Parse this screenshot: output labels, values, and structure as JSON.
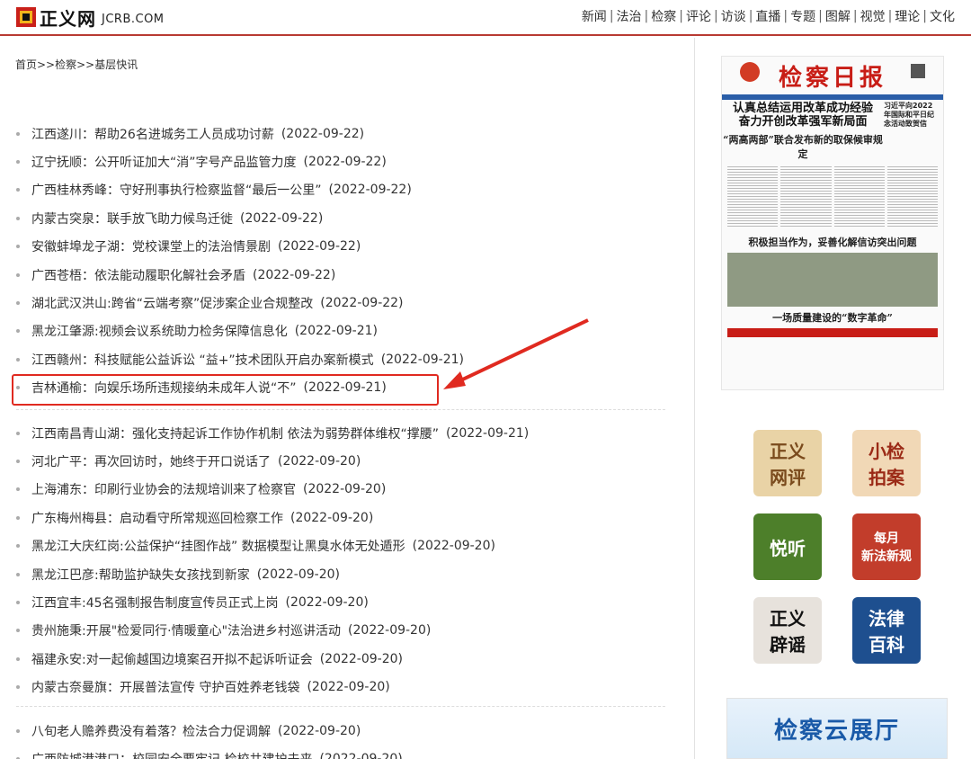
{
  "header": {
    "logo_cn": "正义网",
    "logo_en": "JCRB.COM",
    "nav": [
      "新闻",
      "法治",
      "检察",
      "评论",
      "访谈",
      "直播",
      "专题",
      "图解",
      "视觉",
      "理论",
      "文化"
    ]
  },
  "breadcrumb": "首页>>检察>>基层快讯",
  "news_group_1": [
    {
      "title": "江西遂川：帮助26名进城务工人员成功讨薪",
      "date": "(2022-09-22)"
    },
    {
      "title": "辽宁抚顺：公开听证加大“消”字号产品监管力度",
      "date": "(2022-09-22)"
    },
    {
      "title": "广西桂林秀峰：守好刑事执行检察监督“最后一公里”",
      "date": "(2022-09-22)"
    },
    {
      "title": "内蒙古突泉：联手放飞助力候鸟迁徙",
      "date": "(2022-09-22)"
    },
    {
      "title": "安徽蚌埠龙子湖：党校课堂上的法治情景剧",
      "date": "(2022-09-22)"
    },
    {
      "title": "广西苍梧：依法能动履职化解社会矛盾",
      "date": "(2022-09-22)"
    },
    {
      "title": "湖北武汉洪山:跨省“云端考察”促涉案企业合规整改",
      "date": "(2022-09-22)"
    },
    {
      "title": "黑龙江肇源:视频会议系统助力检务保障信息化",
      "date": "(2022-09-21)"
    },
    {
      "title": "江西赣州：科技赋能公益诉讼 “益+”技术团队开启办案新模式",
      "date": "(2022-09-21)"
    },
    {
      "title": "吉林通榆：向娱乐场所违规接纳未成年人说“不”",
      "date": "(2022-09-21)"
    }
  ],
  "news_group_2": [
    {
      "title": "江西南昌青山湖：强化支持起诉工作协作机制 依法为弱势群体维权“撑腰”",
      "date": "(2022-09-21)"
    },
    {
      "title": "河北广平：再次回访时，她终于开口说话了",
      "date": "(2022-09-20)"
    },
    {
      "title": "上海浦东：印刷行业协会的法规培训来了检察官",
      "date": "(2022-09-20)"
    },
    {
      "title": "广东梅州梅县：启动看守所常规巡回检察工作",
      "date": "(2022-09-20)"
    },
    {
      "title": "黑龙江大庆红岗:公益保护“挂图作战” 数据模型让黑臭水体无处遁形",
      "date": "(2022-09-20)"
    },
    {
      "title": "黑龙江巴彦:帮助监护缺失女孩找到新家",
      "date": "(2022-09-20)"
    },
    {
      "title": "江西宜丰:45名强制报告制度宣传员正式上岗",
      "date": "(2022-09-20)"
    },
    {
      "title": "贵州施秉:开展\"检爱同行·情暖童心\"法治进乡村巡讲活动",
      "date": "(2022-09-20)"
    },
    {
      "title": "福建永安:对一起偷越国边境案召开拟不起诉听证会",
      "date": "(2022-09-20)"
    },
    {
      "title": "内蒙古奈曼旗：开展普法宣传 守护百姓养老钱袋",
      "date": "(2022-09-20)"
    }
  ],
  "news_group_3": [
    {
      "title": "八旬老人赡养费没有着落？检法合力促调解",
      "date": "(2022-09-20)"
    },
    {
      "title": "广西防城港港口：校园安全要牢记 检校共建护未来",
      "date": "(2022-09-20)"
    }
  ],
  "newspaper": {
    "title": "检察日报",
    "headline1": "认真总结运用改革成功经验",
    "headline2": "奋力开创改革强军新局面",
    "sub1": "“两高两部”联合发布新的取保候审规定",
    "sub2": "积极担当作为，妥善化解信访突出问题",
    "sub3": "一场质量建设的“数字革命”",
    "side": "习近平向2022年国际和平日纪念活动致贺信"
  },
  "tiles": [
    {
      "label": "正义\n网评",
      "color": "#7a4a1c",
      "bg": "#e9d3a6"
    },
    {
      "label": "小检\n拍案",
      "color": "#9b2a16",
      "bg": "#f1d8b6"
    },
    {
      "label": "悦听",
      "color": "#ffffff",
      "bg": "#4d7f2a"
    },
    {
      "label": "每月\n新法新规",
      "color": "#ffffff",
      "bg": "#c23d2b"
    },
    {
      "label": "正义\n辟谣",
      "color": "#111111",
      "bg": "#e7e2dc"
    },
    {
      "label": "法律\n百科",
      "color": "#ffffff",
      "bg": "#1e4f8f"
    }
  ],
  "cloud": "检察云展厅",
  "colors": {
    "accent": "#b83a32",
    "highlight": "#e02a20"
  }
}
